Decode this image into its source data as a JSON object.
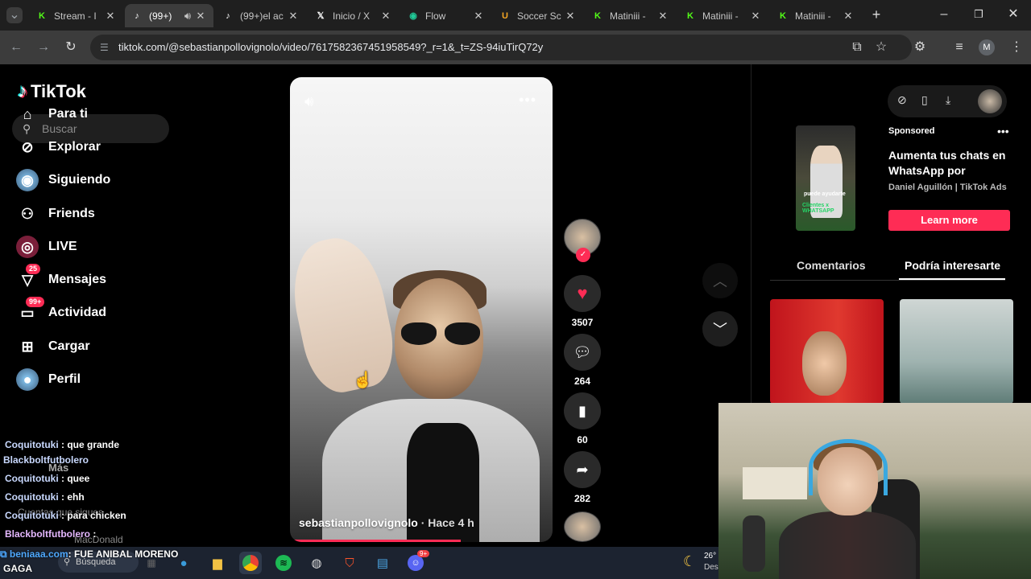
{
  "browser": {
    "tabs": [
      {
        "title": "Stream - I",
        "favicon": "K",
        "color": "#53fc18",
        "active": false
      },
      {
        "title": "(99+) ",
        "favicon": "♪",
        "color": "#ffffff",
        "active": true
      },
      {
        "title": "(99+)el ac",
        "favicon": "♪",
        "color": "#ffffff",
        "active": false
      },
      {
        "title": "Inicio / X",
        "favicon": "𝕏",
        "color": "#ffffff",
        "active": false
      },
      {
        "title": "Flow",
        "favicon": "◉",
        "color": "#20c997",
        "active": false
      },
      {
        "title": "Soccer Sc",
        "favicon": "U",
        "color": "#f5a623",
        "active": false
      },
      {
        "title": "Matiniii -",
        "favicon": "K",
        "color": "#53fc18",
        "active": false
      },
      {
        "title": "Matiniii -",
        "favicon": "K",
        "color": "#53fc18",
        "active": false
      },
      {
        "title": "Matiniii -",
        "favicon": "K",
        "color": "#53fc18",
        "active": false
      }
    ],
    "url": "tiktok.com/@sebastianpollovignolo/video/7617582367451958549?_r=1&_t=ZS-94iuTirQ72y",
    "profile_initial": "M"
  },
  "sidebar": {
    "logo_text": "TikTok",
    "search_placeholder": "Buscar",
    "items": [
      {
        "label": "Para ti",
        "icon": "home-icon",
        "glyph": "⌂"
      },
      {
        "label": "Explorar",
        "icon": "compass-icon",
        "glyph": "⊘"
      },
      {
        "label": "Siguiendo",
        "icon": "following-avatar-icon",
        "glyph": "◉"
      },
      {
        "label": "Friends",
        "icon": "friends-icon",
        "glyph": "⚇"
      },
      {
        "label": "LIVE",
        "icon": "live-icon",
        "glyph": "◎"
      },
      {
        "label": "Mensajes",
        "icon": "messages-icon",
        "glyph": "▽",
        "badge": "25"
      },
      {
        "label": "Actividad",
        "icon": "activity-icon",
        "glyph": "▭",
        "badge": "99+"
      },
      {
        "label": "Cargar",
        "icon": "upload-icon",
        "glyph": "⊞"
      },
      {
        "label": "Perfil",
        "icon": "profile-avatar-icon",
        "glyph": "●"
      }
    ],
    "more_label": "Más",
    "following_accounts_label": "Cuentas que sigues",
    "partial_account_label": "MacDonald"
  },
  "video": {
    "author": "sebastianpollovignolo",
    "time_ago": "Hace 4 h",
    "progress": 0.65
  },
  "actions": {
    "likes": "3507",
    "comments": "264",
    "saves": "60",
    "shares": "282"
  },
  "ad": {
    "sponsored_label": "Sponsored",
    "title": "Aumenta tus chats en WhatsApp por medio...",
    "advertiser": "Daniel Aguillón | TikTok Ads",
    "cta": "Learn more",
    "thumb_text_top": "puede ayudarte",
    "thumb_text": "Clientes x WHATSAPP"
  },
  "right_tabs": {
    "comments": "Comentarios",
    "suggested": "Podría interesarte"
  },
  "chat": [
    {
      "user": "Coquitotuki",
      "msg": ": que grande"
    },
    {
      "user": "Blackboltfutbolero",
      "msg": ""
    },
    {
      "user": "Coquitotuki",
      "msg": ": quee"
    },
    {
      "user": "Coquitotuki",
      "msg": ": ehh"
    },
    {
      "user": "Coquitotuki",
      "msg": ": para chicken"
    },
    {
      "user": "Blackboltfutbolero",
      "msg": ":"
    }
  ],
  "ticker": {
    "link": "beniaaa.com",
    "text": ": FUE ANIBAL MORENO",
    "line2": "GAGA"
  },
  "taskbar": {
    "search_label": "Búsqueda",
    "temp": "26°",
    "weather_text": "Des",
    "discord_badge": "9+"
  },
  "colors": {
    "accent": "#fe2c55",
    "kick": "#53fc18"
  }
}
